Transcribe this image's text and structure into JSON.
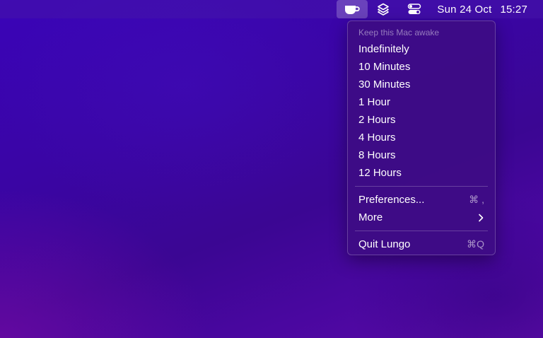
{
  "menubar": {
    "icons": [
      "coffee-cup-icon",
      "layers-icon",
      "control-center-icon"
    ],
    "date": "Sun 24 Oct",
    "time": "15:27"
  },
  "menu": {
    "header": "Keep this Mac awake",
    "durations": [
      {
        "label": "Indefinitely"
      },
      {
        "label": "10 Minutes"
      },
      {
        "label": "30 Minutes"
      },
      {
        "label": "1 Hour"
      },
      {
        "label": "2 Hours"
      },
      {
        "label": "4 Hours"
      },
      {
        "label": "8 Hours"
      },
      {
        "label": "12 Hours"
      }
    ],
    "preferences": {
      "label": "Preferences...",
      "shortcut": "⌘ ,"
    },
    "more": {
      "label": "More",
      "icon": "chevron-right-icon"
    },
    "quit": {
      "label": "Quit Lungo",
      "shortcut": "⌘Q"
    }
  },
  "colors": {
    "wallpaper": "#3b0693",
    "menu_bg": "#3e0c84",
    "text": "#ffffff"
  }
}
